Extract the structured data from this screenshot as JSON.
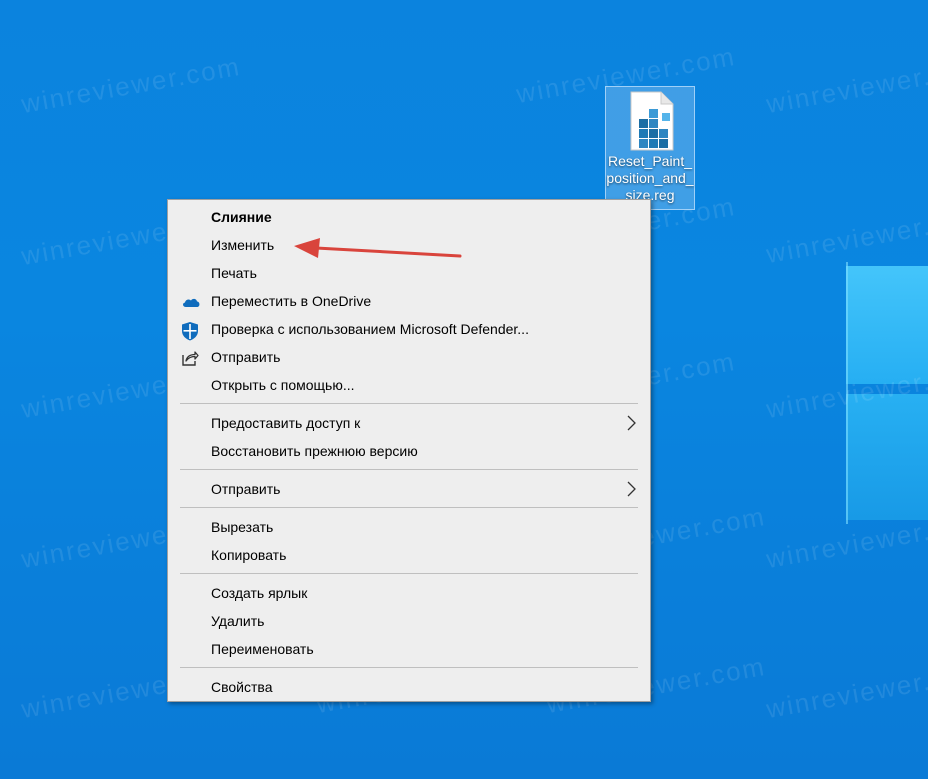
{
  "desktop": {
    "background_color": "#0a7fd8",
    "watermark_text": "winreviewer.com",
    "icon": {
      "label": "Reset_Paint_position_and_size.reg",
      "icon_name": "registry-file-icon"
    }
  },
  "context_menu": {
    "groups": [
      [
        {
          "label": "Слияние",
          "bold": true
        },
        {
          "label": "Изменить"
        },
        {
          "label": "Печать"
        },
        {
          "label": "Переместить в OneDrive",
          "icon": "onedrive-cloud-icon"
        },
        {
          "label": "Проверка с использованием Microsoft Defender...",
          "icon": "defender-shield-icon"
        },
        {
          "label": "Отправить",
          "icon": "share-icon"
        },
        {
          "label": "Открыть с помощью..."
        }
      ],
      [
        {
          "label": "Предоставить доступ к",
          "submenu": true
        },
        {
          "label": "Восстановить прежнюю версию"
        }
      ],
      [
        {
          "label": "Отправить",
          "submenu": true
        }
      ],
      [
        {
          "label": "Вырезать"
        },
        {
          "label": "Копировать"
        }
      ],
      [
        {
          "label": "Создать ярлык"
        },
        {
          "label": "Удалить"
        },
        {
          "label": "Переименовать"
        }
      ],
      [
        {
          "label": "Свойства"
        }
      ]
    ]
  },
  "annotation": {
    "type": "arrow",
    "color": "#d9443c",
    "points_to": "Изменить"
  }
}
